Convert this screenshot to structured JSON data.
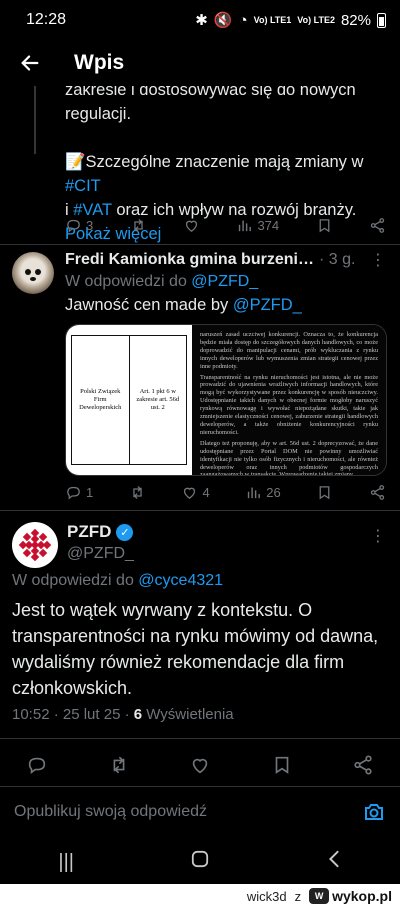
{
  "status": {
    "time": "12:28",
    "sim1": "Vo) LTE1",
    "sim2": "Vo) LTE2",
    "battery": "82%"
  },
  "header": {
    "title": "Wpis"
  },
  "tweet1": {
    "text_line1": "zakresie i dostosowywać się do nowych",
    "text_line2": "regulacji.",
    "special_prefix": "📝Szczególne znaczenie mają zmiany w ",
    "tag_cit": "#CIT",
    "mid1": "i ",
    "tag_vat": "#VAT",
    "mid2": " oraz ich wpływ na rozwój branży.",
    "show_more": "Pokaż więcej",
    "replies": "3",
    "views": "374"
  },
  "tweet2": {
    "name": "Fredi Kamionka gmina burzenin …",
    "time": "· 3 g.",
    "reply_prefix": "W odpowiedzi do ",
    "reply_handle": "@PZFD_",
    "text_prefix": "Jawność cen made by ",
    "text_handle": "@PZFD_",
    "image_left": {
      "col1": "Polski Związek Firm Deweloperskich",
      "col2": "Art. 1 pkt 6 w zakresie art. 56d ust. 2"
    },
    "image_right": {
      "p1": "naruszeń zasad uczciwej konkurencji. Oznacza to, że konkurencja będzie miała dostęp do szczegółowych danych handlowych, co może doprowadzić do manipulacji cenami, prób wykluczania z rynku innych deweloperów lub wymuszenia zmian strategii cenowej przez inne podmioty.",
      "p2": "Transparentność na rynku nieruchomości jest istotna, ale nie może prowadzić do ujawnienia wrażliwych informacji handlowych, które mogą być wykorzystywane przez konkurencję w sposób nieuczciwy. Udostępnianie takich danych w obecnej formie mogłoby naruszyć rynkową równowagę i wywołać niepożądane skutki, takie jak zmniejszenie elastyczności cenowej, zaburzenie strategii handlowych deweloperów, a także obniżenie konkurencyjności rynku nieruchomości.",
      "p3": "Dlatego też proponuję, aby w art. 56d ust. 2 doprecyzować, że dane udostępniane przez Portal DOM nie powinny umożliwiać identyfikacji nie tylko osób fizycznych i nieruchomości, ale również deweloperów oraz innych podmiotów gospodarczych zaangażowanych w transakcje. Wprowadzenie takiej zmiany"
    },
    "replies": "1",
    "likes": "4",
    "views": "26"
  },
  "main_tweet": {
    "name": "PZFD",
    "handle": "@PZFD_",
    "reply_prefix": "W odpowiedzi do ",
    "reply_handle": "@cyce4321",
    "text": "Jest to wątek wyrwany z kontekstu. O transparentności na rynku mówimy od dawna, wydaliśmy również rekomendacje dla firm członkowskich.",
    "meta_prefix": "10:52 · 25 lut 25 · ",
    "meta_views": "6",
    "meta_suffix": " Wyświetlenia"
  },
  "reply_bar": {
    "placeholder": "Opublikuj swoją odpowiedź"
  },
  "watermark": {
    "user": "wick3d",
    "z": "z",
    "site": "wykop.pl"
  },
  "colors": {
    "accent": "#1d9bf0",
    "muted": "#71767b",
    "background": "#000000",
    "brand_red": "#c8102e"
  }
}
